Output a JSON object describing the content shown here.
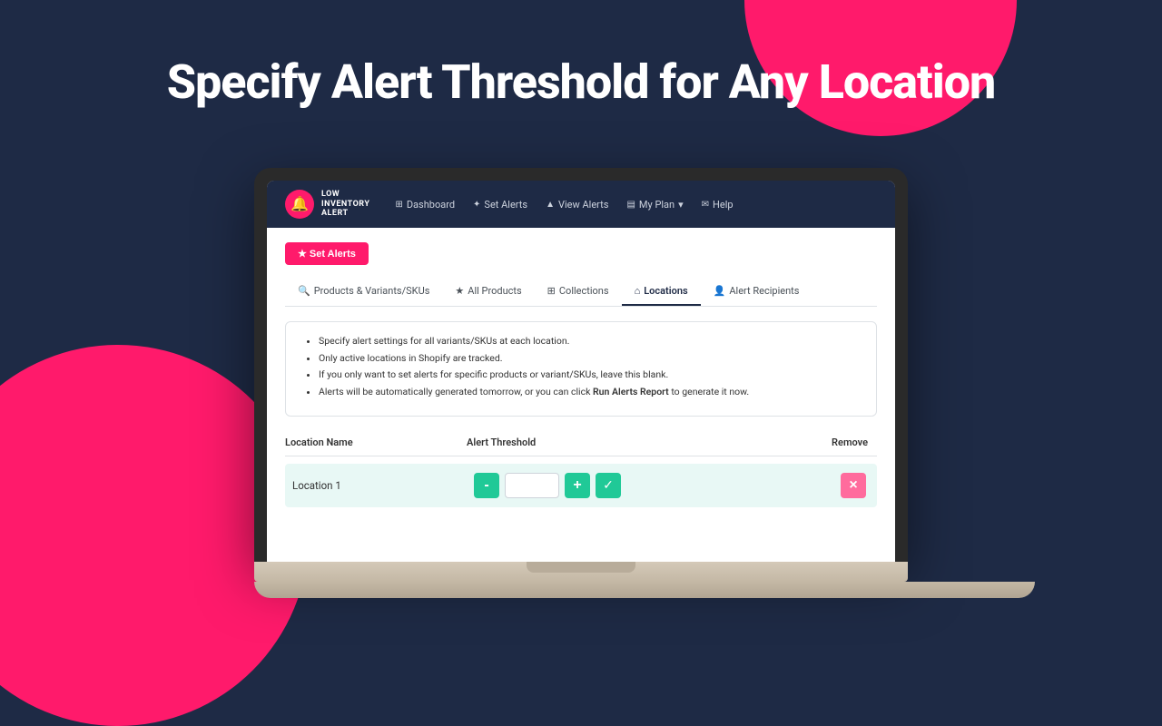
{
  "page": {
    "title": "Specify Alert Threshold for Any Location",
    "background_color": "#1e2a45"
  },
  "navbar": {
    "logo": {
      "icon": "🔔",
      "line1": "LOW",
      "line2": "INVENTORY",
      "line3": "ALERT"
    },
    "links": [
      {
        "id": "dashboard",
        "icon": "⊞",
        "label": "Dashboard"
      },
      {
        "id": "set-alerts",
        "icon": "✦",
        "label": "Set Alerts"
      },
      {
        "id": "view-alerts",
        "icon": "▲",
        "label": "View Alerts"
      },
      {
        "id": "my-plan",
        "icon": "▤",
        "label": "My Plan",
        "has_dropdown": true
      },
      {
        "id": "help",
        "icon": "✉",
        "label": "Help"
      }
    ]
  },
  "content": {
    "set_alerts_button": "★  Set Alerts",
    "tabs": [
      {
        "id": "products-variants",
        "icon": "🔍",
        "label": "Products & Variants/SKUs",
        "active": false
      },
      {
        "id": "all-products",
        "icon": "★",
        "label": "All Products",
        "active": false
      },
      {
        "id": "collections",
        "icon": "⊞",
        "label": "Collections",
        "active": false
      },
      {
        "id": "locations",
        "icon": "⌂",
        "label": "Locations",
        "active": true
      },
      {
        "id": "alert-recipients",
        "icon": "👤",
        "label": "Alert Recipients",
        "active": false
      }
    ],
    "info_bullets": [
      "Specify alert settings for all variants/SKUs at each location.",
      "Only active locations in Shopify are tracked.",
      "If you only want to set alerts for specific products or variant/SKUs, leave this blank.",
      "Alerts will be automatically generated tomorrow, or you can click Run Alerts Report to generate it now."
    ],
    "run_alerts_link": "Run Alerts Report",
    "table": {
      "columns": [
        {
          "id": "location-name",
          "label": "Location Name"
        },
        {
          "id": "alert-threshold",
          "label": "Alert Threshold"
        },
        {
          "id": "remove",
          "label": "Remove"
        }
      ],
      "rows": [
        {
          "id": "location-1",
          "name": "Location 1",
          "threshold_value": "",
          "actions": {
            "minus": "-",
            "plus": "+",
            "check": "✓",
            "remove": "×"
          }
        }
      ]
    }
  }
}
